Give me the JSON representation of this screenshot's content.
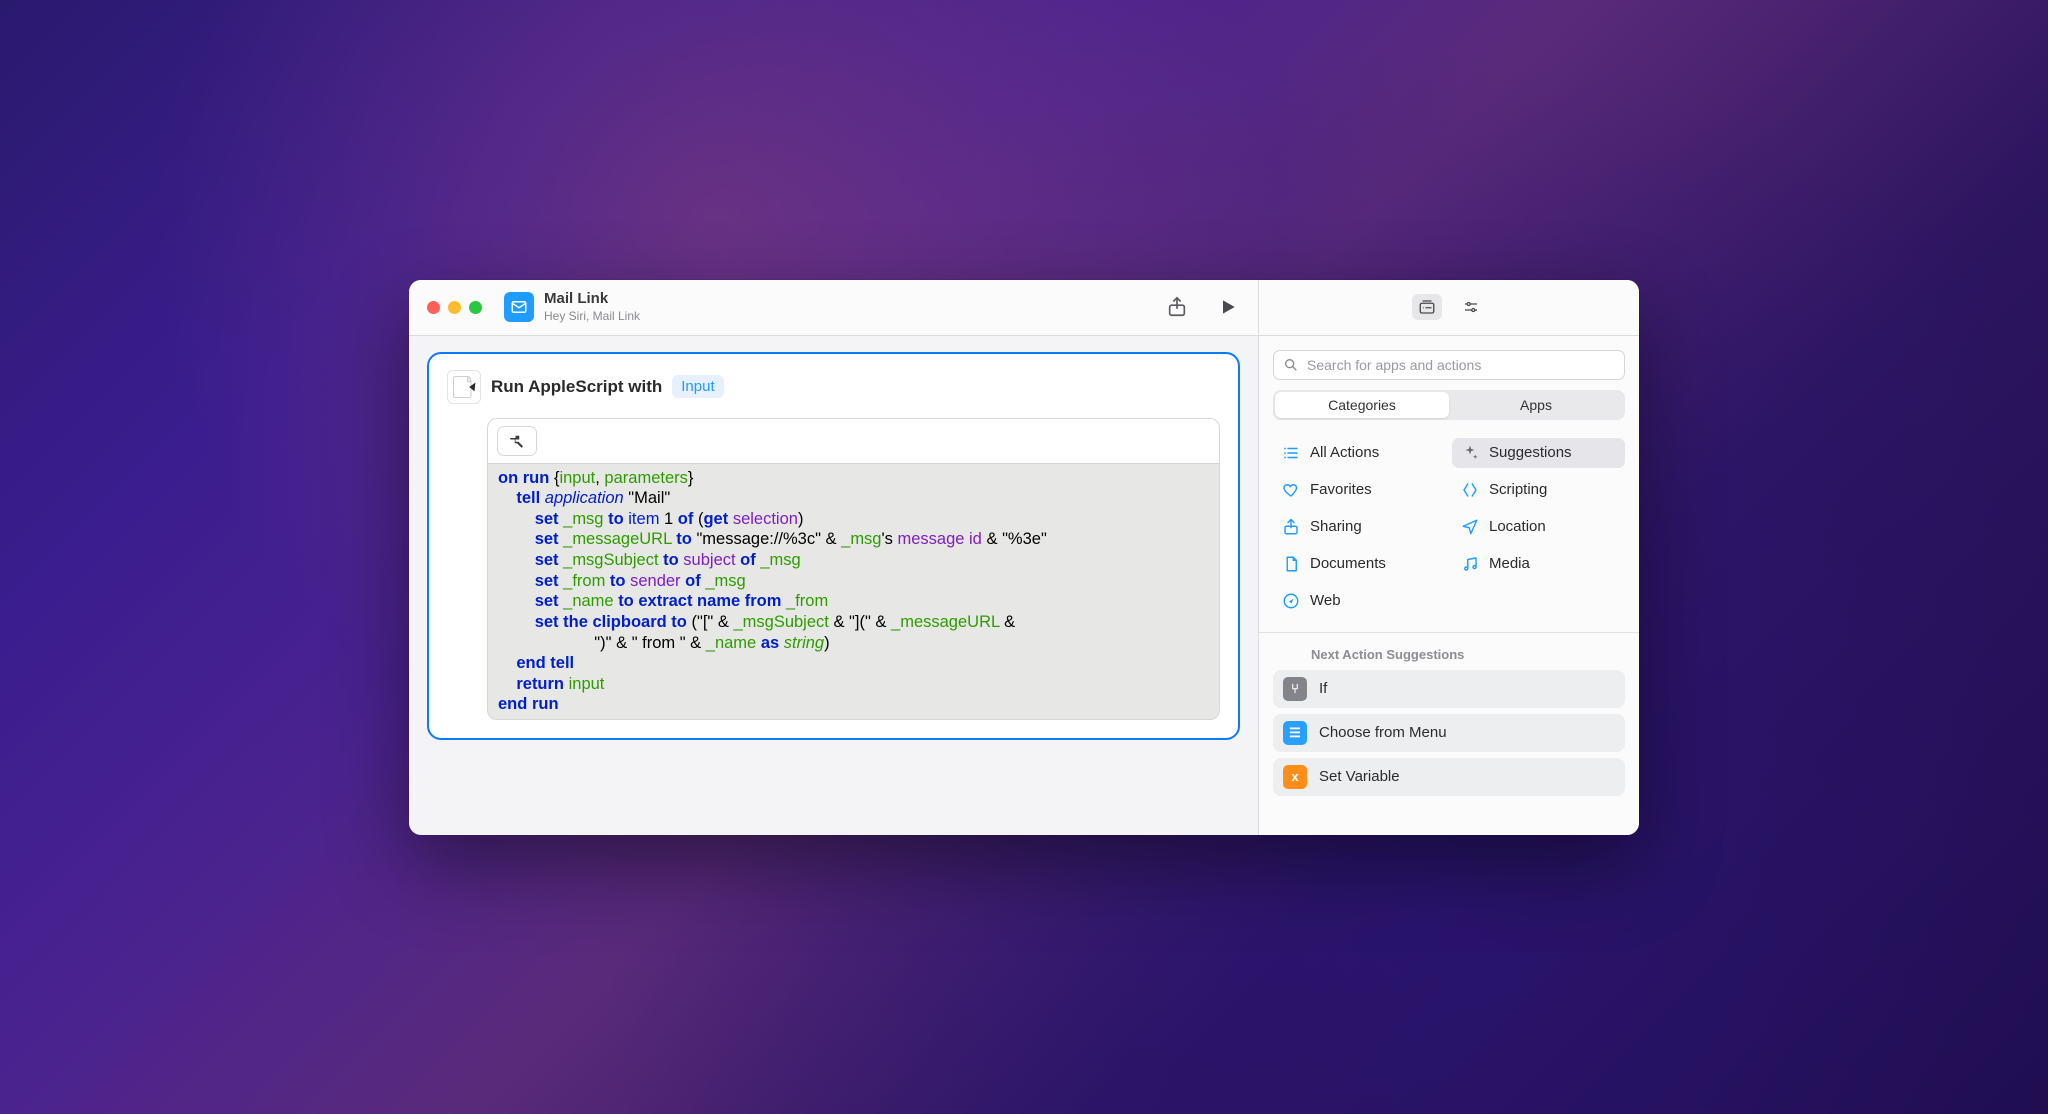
{
  "window": {
    "title": "Mail Link",
    "subtitle": "Hey Siri, Mail Link"
  },
  "action": {
    "title_prefix": "Run AppleScript with",
    "input_pill": "Input",
    "code_html": "<span class=\"kw\">on</span> <span class=\"kw\">run</span> {<span class=\"grn\">input</span>, <span class=\"grn\">parameters</span>}\n    <span class=\"kw\">tell</span> <span class=\"kwi\">application</span> <span class=\"str\">\"Mail\"</span>\n        <span class=\"kw\">set</span> <span class=\"grn\">_msg</span> <span class=\"kw\">to</span> <span class=\"kw2\">item</span> 1 <span class=\"kw\">of</span> (<span class=\"kw\">get</span> <span class=\"pur\">selection</span>)\n        <span class=\"kw\">set</span> <span class=\"grn\">_messageURL</span> <span class=\"kw\">to</span> <span class=\"str\">\"message://%3c\"</span> &amp; <span class=\"grn\">_msg</span>'s <span class=\"pur\">message id</span> &amp; <span class=\"str\">\"%3e\"</span>\n        <span class=\"kw\">set</span> <span class=\"grn\">_msgSubject</span> <span class=\"kw\">to</span> <span class=\"pur\">subject</span> <span class=\"kw\">of</span> <span class=\"grn\">_msg</span>\n        <span class=\"kw\">set</span> <span class=\"grn\">_from</span> <span class=\"kw\">to</span> <span class=\"pur\">sender</span> <span class=\"kw\">of</span> <span class=\"grn\">_msg</span>\n        <span class=\"kw\">set</span> <span class=\"grn\">_name</span> <span class=\"kw\">to</span> <span class=\"kw\">extract name from</span> <span class=\"grn\">_from</span>\n        <span class=\"kw\">set the clipboard to</span> (<span class=\"str\">\"[\"</span> &amp; <span class=\"grn\">_msgSubject</span> &amp; <span class=\"str\">\"](\"</span> &amp; <span class=\"grn\">_messageURL</span> &amp;\n                     <span class=\"str\">\")\"</span> &amp; <span class=\"str\">\" from \"</span> &amp; <span class=\"grn\">_name</span> <span class=\"kw\">as</span> <span class=\"grni\">string</span>)\n    <span class=\"kw\">end</span> <span class=\"kw\">tell</span>\n    <span class=\"kw\">return</span> <span class=\"grn\">input</span>\n<span class=\"kw\">end</span> <span class=\"kw\">run</span>"
  },
  "sidebar": {
    "search_placeholder": "Search for apps and actions",
    "segments": {
      "categories": "Categories",
      "apps": "Apps",
      "active": "categories"
    },
    "categories": [
      {
        "id": "all",
        "label": "All Actions",
        "icon": "list",
        "color": "#1f9cff"
      },
      {
        "id": "sugg",
        "label": "Suggestions",
        "icon": "sparkle",
        "color": "#6b6b70",
        "selected": true
      },
      {
        "id": "fav",
        "label": "Favorites",
        "icon": "heart",
        "color": "#1f9cff"
      },
      {
        "id": "scripting",
        "label": "Scripting",
        "icon": "script",
        "color": "#1f9cff"
      },
      {
        "id": "sharing",
        "label": "Sharing",
        "icon": "share",
        "color": "#1f9cff"
      },
      {
        "id": "location",
        "label": "Location",
        "icon": "location",
        "color": "#1f9cff"
      },
      {
        "id": "documents",
        "label": "Documents",
        "icon": "doc",
        "color": "#1f9cff"
      },
      {
        "id": "media",
        "label": "Media",
        "icon": "music",
        "color": "#1f9cff"
      },
      {
        "id": "web",
        "label": "Web",
        "icon": "compass",
        "color": "#1f9cff"
      }
    ],
    "suggestions_title": "Next Action Suggestions",
    "suggestions": [
      {
        "label": "If",
        "badge_class": "b-gray",
        "glyph": "⑂"
      },
      {
        "label": "Choose from Menu",
        "badge_class": "b-blue",
        "glyph": "☰"
      },
      {
        "label": "Set Variable",
        "badge_class": "b-orange",
        "glyph": "x"
      }
    ]
  }
}
